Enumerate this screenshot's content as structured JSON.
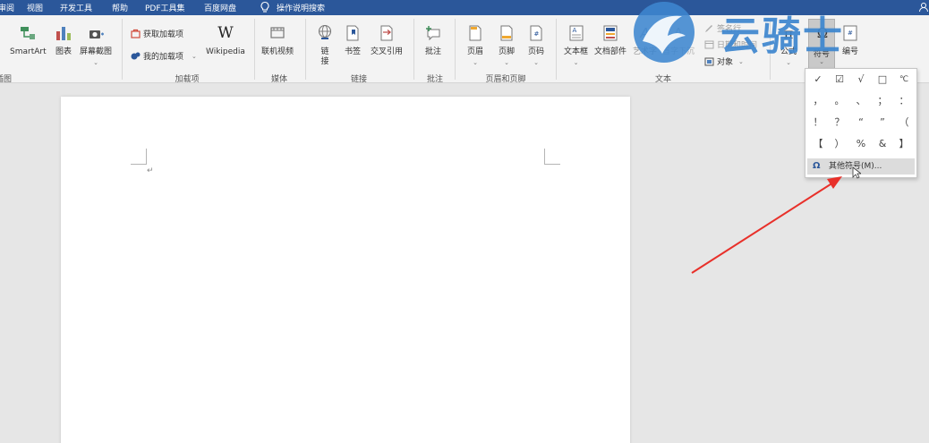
{
  "menubar": {
    "items": [
      "审阅",
      "视图",
      "开发工具",
      "帮助",
      "PDF工具集",
      "百度网盘"
    ],
    "search": "操作说明搜索",
    "user_icon": "person-icon"
  },
  "ribbon": {
    "illustrations": {
      "smartart": "SmartArt",
      "chart": "图表",
      "screenshot": "屏幕截图",
      "group_label": "插图"
    },
    "addins": {
      "get_addins": "获取加载项",
      "my_addins": "我的加载项",
      "wikipedia": "Wikipedia",
      "group_label": "加载项"
    },
    "media": {
      "online_video": "联机视频",
      "group_label": "媒体"
    },
    "links": {
      "link_line1": "链",
      "link_line2": "接",
      "bookmark": "书签",
      "cross_reference": "交叉引用",
      "group_label": "链接"
    },
    "comments": {
      "comment": "批注",
      "group_label": "批注"
    },
    "header_footer": {
      "header": "页眉",
      "footer": "页脚",
      "page_number": "页码",
      "group_label": "页眉和页脚"
    },
    "text": {
      "text_box": "文本框",
      "quick_parts": "文档部件",
      "wordart": "艺术字",
      "drop_cap": "首字下沉",
      "signature_line": "签名行",
      "date_time": "日期和时间",
      "object": "对象",
      "group_label": "文本"
    },
    "symbols": {
      "equation": "公式",
      "symbol": "符号",
      "number": "编号"
    }
  },
  "symbol_dropdown": {
    "symbols": [
      "✓",
      "☑",
      "√",
      "□",
      "℃",
      "，",
      "。",
      "、",
      "；",
      "：",
      "！",
      "？",
      "“",
      "”",
      "（",
      "【",
      "）",
      "%",
      "&",
      "】"
    ],
    "more_symbols": "其他符号(M)..."
  },
  "document": {
    "paragraph_mark": "↵"
  },
  "watermark": {
    "text": "云骑士"
  },
  "colors": {
    "accent": "#2b579a",
    "watermark": "#3d86cf",
    "arrow": "#e8302a"
  }
}
